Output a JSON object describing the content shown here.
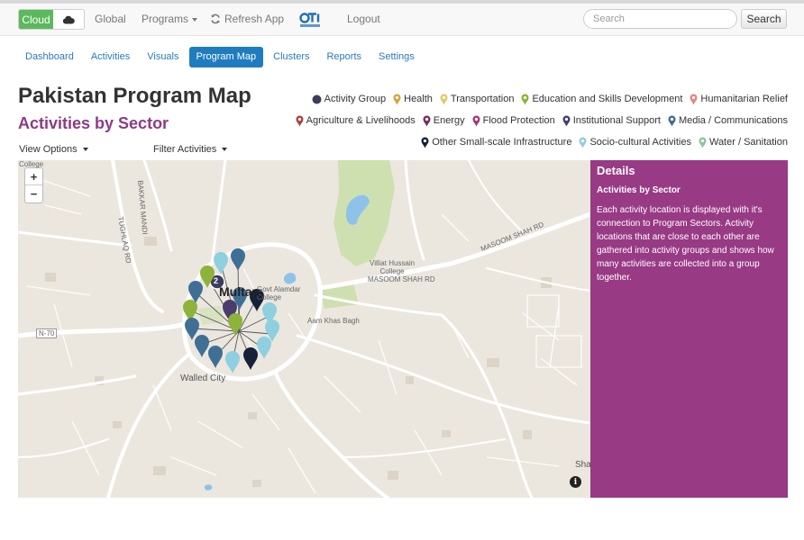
{
  "navbar": {
    "cloud_label": "Cloud",
    "links": {
      "global": "Global",
      "programs": "Programs",
      "refresh": "Refresh App",
      "logout": "Logout"
    },
    "search_placeholder": "Search",
    "search_button": "Search"
  },
  "tabs": [
    {
      "label": "Dashboard",
      "active": false
    },
    {
      "label": "Activities",
      "active": false
    },
    {
      "label": "Visuals",
      "active": false
    },
    {
      "label": "Program Map",
      "active": true
    },
    {
      "label": "Clusters",
      "active": false
    },
    {
      "label": "Reports",
      "active": false
    },
    {
      "label": "Settings",
      "active": false
    }
  ],
  "page": {
    "title": "Pakistan Program Map",
    "subtitle": "Activities by Sector"
  },
  "legend": [
    {
      "label": "Activity Group",
      "color": "#3c3c5e",
      "shape": "circle"
    },
    {
      "label": "Health",
      "color": "#d8a23c",
      "shape": "pin"
    },
    {
      "label": "Transportation",
      "color": "#e4c96a",
      "shape": "pin"
    },
    {
      "label": "Education and Skills Development",
      "color": "#8db33a",
      "shape": "pin"
    },
    {
      "label": "Humanitarian Relief",
      "color": "#e08a80",
      "shape": "pin"
    },
    {
      "label": "Agriculture & Livelihoods",
      "color": "#b14040",
      "shape": "pin"
    },
    {
      "label": "Energy",
      "color": "#7a2e5c",
      "shape": "pin"
    },
    {
      "label": "Flood Protection",
      "color": "#a43b7c",
      "shape": "pin"
    },
    {
      "label": "Institutional Support",
      "color": "#4a3d6e",
      "shape": "pin"
    },
    {
      "label": "Media / Communications",
      "color": "#3f6f95",
      "shape": "pin"
    },
    {
      "label": "Other Small-scale Infrastructure",
      "color": "#152238",
      "shape": "pin"
    },
    {
      "label": "Socio-cultural Activities",
      "color": "#8ecfe0",
      "shape": "pin"
    },
    {
      "label": "Water / Sanitation",
      "color": "#8cc4a0",
      "shape": "pin"
    }
  ],
  "options": {
    "view": "View Options",
    "filter": "Filter Activities"
  },
  "map": {
    "zoom_in": "+",
    "zoom_out": "−",
    "cluster_count": "2",
    "labels": {
      "college": "College",
      "bakkar_mandi": "BAKKAR MANDI",
      "tughlaq": "TUGHLAQ RD",
      "masoom_shah_rd_1": "MASOOM SHAH RD",
      "masoom_shah_rd_2": "MASOOM SHAH RD",
      "villiat_college": "Villiat Hussain\nCollege",
      "govt_alamdar": "Govt Alamdar\nCollege",
      "multan": "Multan",
      "aam_khas_bagh": "Aam Khas Bagh",
      "n70": "N-70",
      "walled_city": "Walled City",
      "sha": "Sha"
    },
    "info": "i"
  },
  "details": {
    "title": "Details",
    "subtitle": "Activities by Sector",
    "body": "Each activity location is displayed with it's connection to Program Sectors. Activity locations that are close to each other are gathered into activity groups and shows how many activities are collected into a group together."
  }
}
